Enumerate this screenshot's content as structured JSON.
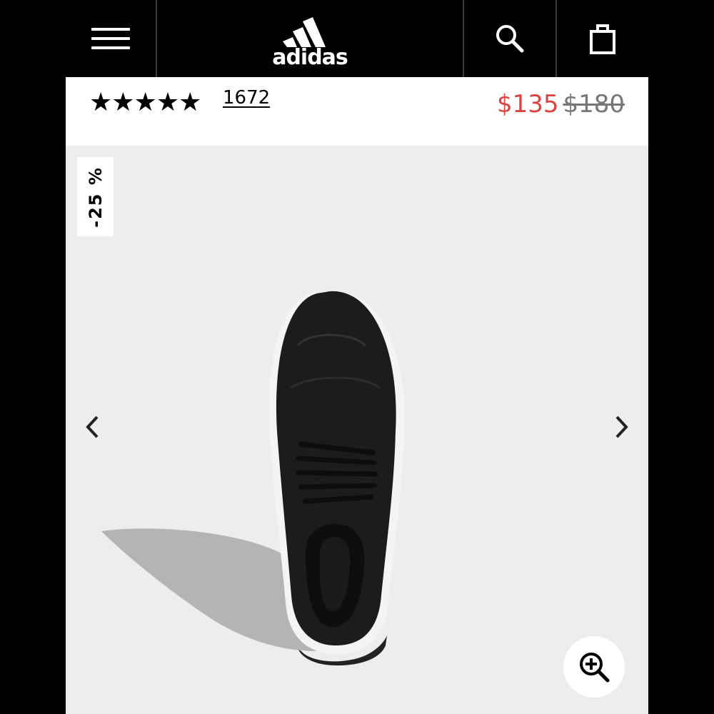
{
  "header": {
    "brand": "adidas",
    "icons": [
      "menu-icon",
      "adidas-logo",
      "search-icon",
      "shopping-bag-icon"
    ]
  },
  "product": {
    "rating_stars": "★★★★★",
    "rating_value": 5,
    "review_count": "1672",
    "sale_price": "$135",
    "original_price": "$180",
    "discount": "-25 %"
  },
  "colors": {
    "header_bg": "#000000",
    "sale_price": "#d64541",
    "original_price": "#777777",
    "gallery_bg": "#ebedee"
  },
  "gallery": {
    "icons": [
      "chevron-left-icon",
      "chevron-right-icon",
      "zoom-in-icon"
    ]
  }
}
